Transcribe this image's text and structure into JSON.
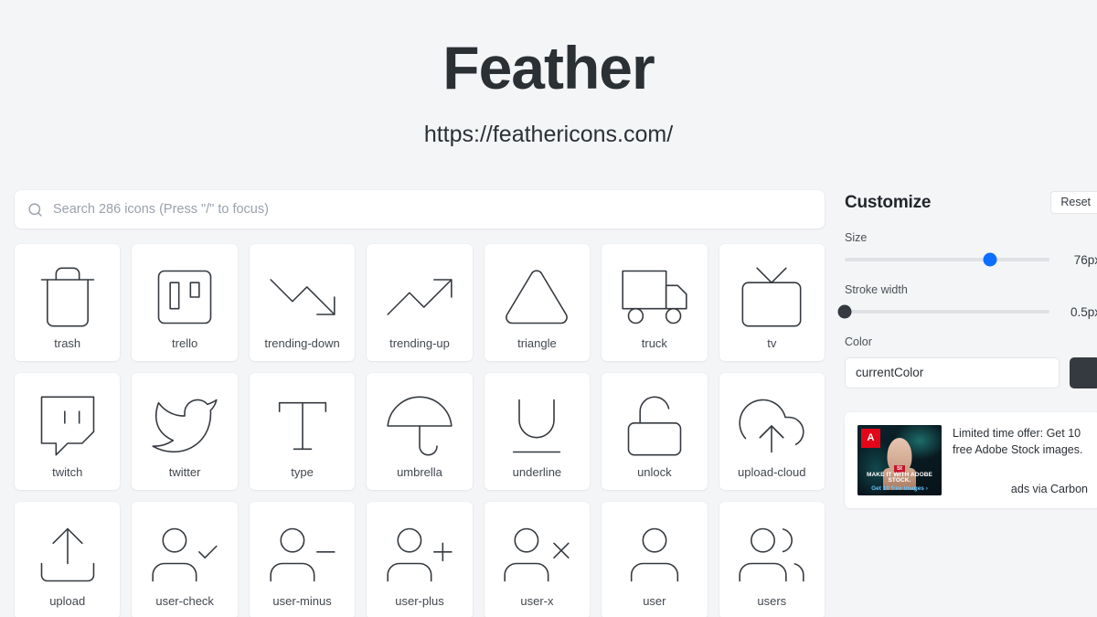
{
  "header": {
    "title": "Feather",
    "url": "https://feathericons.com/"
  },
  "search": {
    "placeholder": "Search 286 icons (Press \"/\" to focus)",
    "value": "",
    "icon": "search-icon",
    "icon_count": 286
  },
  "icons": [
    {
      "name": "trash",
      "glyph": "trash"
    },
    {
      "name": "trello",
      "glyph": "trello"
    },
    {
      "name": "trending-down",
      "glyph": "trending-down"
    },
    {
      "name": "trending-up",
      "glyph": "trending-up"
    },
    {
      "name": "triangle",
      "glyph": "triangle"
    },
    {
      "name": "truck",
      "glyph": "truck"
    },
    {
      "name": "tv",
      "glyph": "tv"
    },
    {
      "name": "twitch",
      "glyph": "twitch"
    },
    {
      "name": "twitter",
      "glyph": "twitter"
    },
    {
      "name": "type",
      "glyph": "type"
    },
    {
      "name": "umbrella",
      "glyph": "umbrella"
    },
    {
      "name": "underline",
      "glyph": "underline"
    },
    {
      "name": "unlock",
      "glyph": "unlock"
    },
    {
      "name": "upload-cloud",
      "glyph": "upload-cloud"
    },
    {
      "name": "upload",
      "glyph": "upload"
    },
    {
      "name": "user-check",
      "glyph": "user-check"
    },
    {
      "name": "user-minus",
      "glyph": "user-minus"
    },
    {
      "name": "user-plus",
      "glyph": "user-plus"
    },
    {
      "name": "user-x",
      "glyph": "user-x"
    },
    {
      "name": "user",
      "glyph": "user"
    },
    {
      "name": "users",
      "glyph": "users"
    }
  ],
  "customize": {
    "title": "Customize",
    "reset_label": "Reset",
    "size": {
      "label": "Size",
      "value": "76px",
      "percent": 71
    },
    "stroke": {
      "label": "Stroke width",
      "value": "0.5px",
      "percent": 0
    },
    "color": {
      "label": "Color",
      "value": "currentColor",
      "swatch_hex": "#343a40"
    },
    "accent_hex": "#0b6efd"
  },
  "ad": {
    "text": "Limited time offer: Get 10 free Adobe Stock images.",
    "via": "ads via Carbon",
    "creative": {
      "brand": "Adobe",
      "badge": "St",
      "caption": "MAKE IT WITH ADOBE STOCK.",
      "cta": "Get 10 free images ›"
    }
  }
}
